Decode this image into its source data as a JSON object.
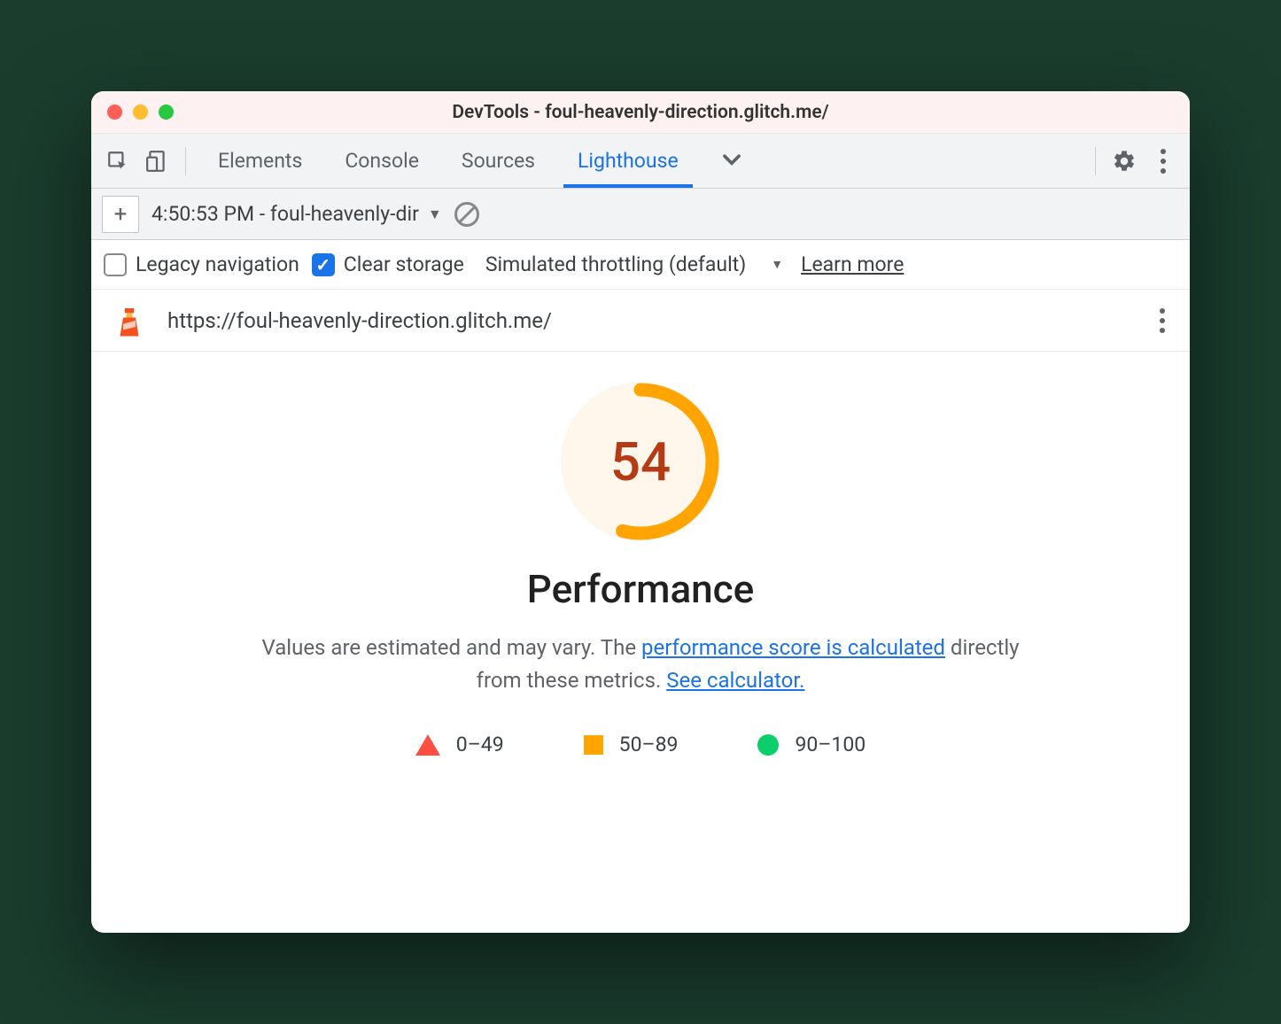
{
  "window": {
    "title": "DevTools - foul-heavenly-direction.glitch.me/"
  },
  "toolbar": {
    "tabs": [
      "Elements",
      "Console",
      "Sources",
      "Lighthouse"
    ],
    "active_tab": "Lighthouse"
  },
  "secondary": {
    "report_label": "4:50:53 PM - foul-heavenly-dir"
  },
  "options": {
    "legacy_label": "Legacy navigation",
    "legacy_checked": false,
    "clear_label": "Clear storage",
    "clear_checked": true,
    "throttling_label": "Simulated throttling (default)",
    "learn_more": "Learn more"
  },
  "url": "https://foul-heavenly-direction.glitch.me/",
  "report": {
    "score": 54,
    "title": "Performance",
    "desc_prefix": "Values are estimated and may vary. The ",
    "link1": "performance score is calculated",
    "desc_mid": " directly from these metrics. ",
    "link2": "See calculator.",
    "legend": {
      "fail": "0–49",
      "avg": "50–89",
      "pass": "90–100"
    }
  },
  "colors": {
    "accent": "#1a73e8",
    "avg": "#ffa400",
    "fail": "#ff4e42",
    "pass": "#0cce6b"
  },
  "chart_data": {
    "type": "gauge",
    "value": 54,
    "min": 0,
    "max": 100,
    "title": "Performance",
    "ranges": [
      {
        "label": "0–49",
        "min": 0,
        "max": 49,
        "color": "#ff4e42"
      },
      {
        "label": "50–89",
        "min": 50,
        "max": 89,
        "color": "#ffa400"
      },
      {
        "label": "90–100",
        "min": 90,
        "max": 100,
        "color": "#0cce6b"
      }
    ]
  }
}
